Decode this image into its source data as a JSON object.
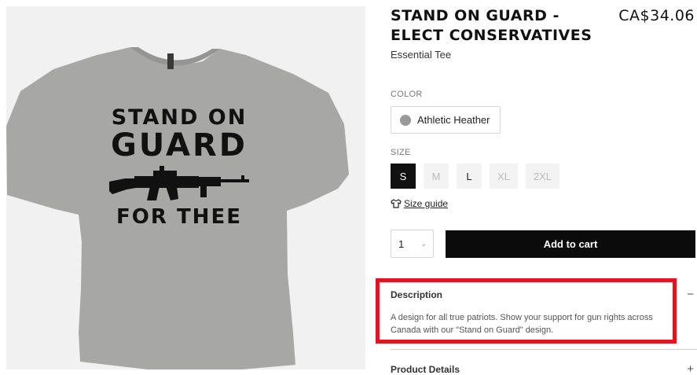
{
  "product": {
    "title": "STAND ON GUARD - ELECT CONSERVATIVES",
    "price": "CA$34.06",
    "subtitle": "Essential Tee"
  },
  "image": {
    "print_line1": "STAND ON",
    "print_line2": "GUARD",
    "print_line3": "FOR THEE",
    "shirt_color": "#a7a8a5"
  },
  "color": {
    "label": "COLOR",
    "selected": "Athletic Heather",
    "swatch_color": "#9a9a9a"
  },
  "size": {
    "label": "SIZE",
    "options": [
      {
        "label": "S",
        "state": "selected"
      },
      {
        "label": "M",
        "state": "unavailable"
      },
      {
        "label": "L",
        "state": "available"
      },
      {
        "label": "XL",
        "state": "unavailable"
      },
      {
        "label": "2XL",
        "state": "unavailable"
      }
    ],
    "guide_label": "Size guide"
  },
  "purchase": {
    "quantity": "1",
    "add_to_cart": "Add to cart"
  },
  "description": {
    "header": "Description",
    "toggle": "−",
    "text": "A design for all true patriots. Show your support for gun rights across Canada with our \"Stand on Guard\" design."
  },
  "product_details": {
    "header": "Product Details",
    "toggle": "+"
  },
  "colors": {
    "highlight": "#e0151d",
    "button_bg": "#0b0b0b"
  }
}
